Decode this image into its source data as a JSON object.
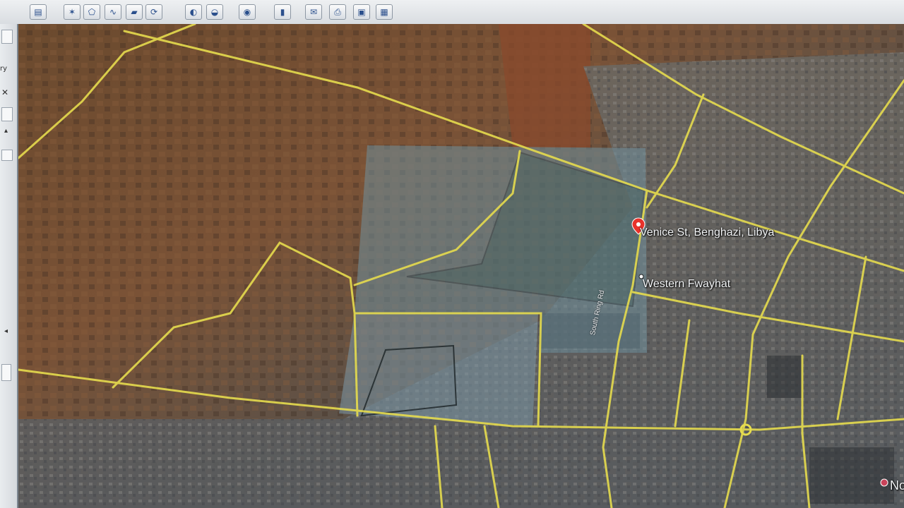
{
  "toolbar": {
    "buttons": [
      {
        "name": "sidebar-toggle-icon",
        "glyph": "▤"
      },
      {
        "name": "placemark-icon",
        "glyph": "✶"
      },
      {
        "name": "polygon-icon",
        "glyph": "⬠"
      },
      {
        "name": "path-icon",
        "glyph": "∿"
      },
      {
        "name": "overlay-icon",
        "glyph": "▰"
      },
      {
        "name": "tour-icon",
        "glyph": "⟳"
      },
      {
        "name": "sun-icon",
        "glyph": "◐"
      },
      {
        "name": "historical-imagery-icon",
        "glyph": "◒"
      },
      {
        "name": "planets-icon",
        "glyph": "◉"
      },
      {
        "name": "ruler-icon",
        "glyph": "▮"
      },
      {
        "name": "email-icon",
        "glyph": "✉"
      },
      {
        "name": "print-icon",
        "glyph": "⎙"
      },
      {
        "name": "save-image-icon",
        "glyph": "▣"
      },
      {
        "name": "view-in-maps-icon",
        "glyph": "▦"
      }
    ]
  },
  "sidebar": {
    "fragment_1": "ry",
    "close_glyph": "✕",
    "arrow_up": "▴",
    "arrow_left": "◂",
    "arrow_right": "›"
  },
  "map": {
    "places": [
      {
        "label": "Venice St, Benghazi, Libya",
        "type": "search-result-pin",
        "color": "#e8322b"
      },
      {
        "label": "Western Fwayhat",
        "type": "locality-dot"
      },
      {
        "label": "No",
        "type": "partial-label"
      }
    ],
    "roads": [
      {
        "label": "South Ring Rd"
      }
    ],
    "colors": {
      "road": "#e6dc4e",
      "overlay": "#6f8f9c",
      "pin": "#e8322b"
    }
  }
}
